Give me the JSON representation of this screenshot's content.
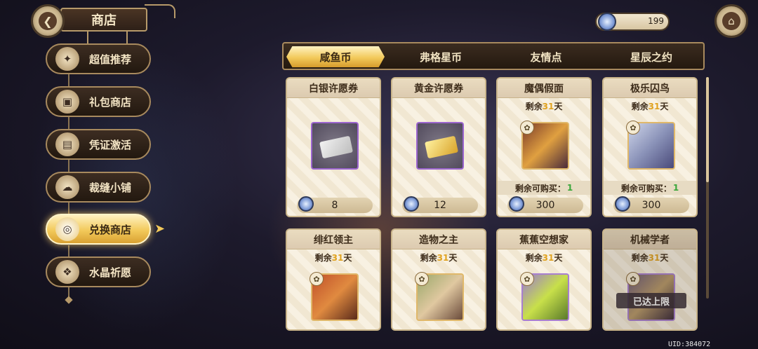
{
  "header": {
    "back_icon": "arrow-left-icon",
    "title": "商店"
  },
  "sidebar": {
    "items": [
      {
        "label": "超值推荐",
        "icon": "bag-icon",
        "active": false
      },
      {
        "label": "礼包商店",
        "icon": "gift-icon",
        "active": false
      },
      {
        "label": "凭证激活",
        "icon": "card-icon",
        "active": false
      },
      {
        "label": "裁缝小铺",
        "icon": "sheep-icon",
        "active": false
      },
      {
        "label": "兑换商店",
        "icon": "coins-icon",
        "active": true
      },
      {
        "label": "水晶祈愿",
        "icon": "crystal-icon",
        "active": false
      }
    ]
  },
  "currency": {
    "icon": "coin-icon",
    "value": "199"
  },
  "home_icon": "home-icon",
  "tabs": [
    {
      "label": "咸鱼币",
      "active": true
    },
    {
      "label": "弗格星币",
      "active": false
    },
    {
      "label": "友情点",
      "active": false
    },
    {
      "label": "星辰之约",
      "active": false
    }
  ],
  "cards": [
    {
      "name": "白银许愿券",
      "type": "ticket-silver",
      "price": "8"
    },
    {
      "name": "黄金许愿券",
      "type": "ticket-gold",
      "price": "12"
    },
    {
      "name": "魔偶假面",
      "remain_prefix": "剩余",
      "remain_num": "31",
      "remain_suffix": "天",
      "buyable_label": "剩余可购买：",
      "buyable_num": "1",
      "price": "300"
    },
    {
      "name": "极乐囚鸟",
      "remain_prefix": "剩余",
      "remain_num": "31",
      "remain_suffix": "天",
      "buyable_label": "剩余可购买：",
      "buyable_num": "1",
      "price": "300"
    },
    {
      "name": "绯红领主",
      "remain_prefix": "剩余",
      "remain_num": "31",
      "remain_suffix": "天"
    },
    {
      "name": "造物之主",
      "remain_prefix": "剩余",
      "remain_num": "31",
      "remain_suffix": "天"
    },
    {
      "name": "蕉蕉空想家",
      "remain_prefix": "剩余",
      "remain_num": "31",
      "remain_suffix": "天"
    },
    {
      "name": "机械学者",
      "remain_prefix": "剩余",
      "remain_num": "31",
      "remain_suffix": "天",
      "limit_label": "已达上限"
    }
  ],
  "uid": "UID:384072"
}
